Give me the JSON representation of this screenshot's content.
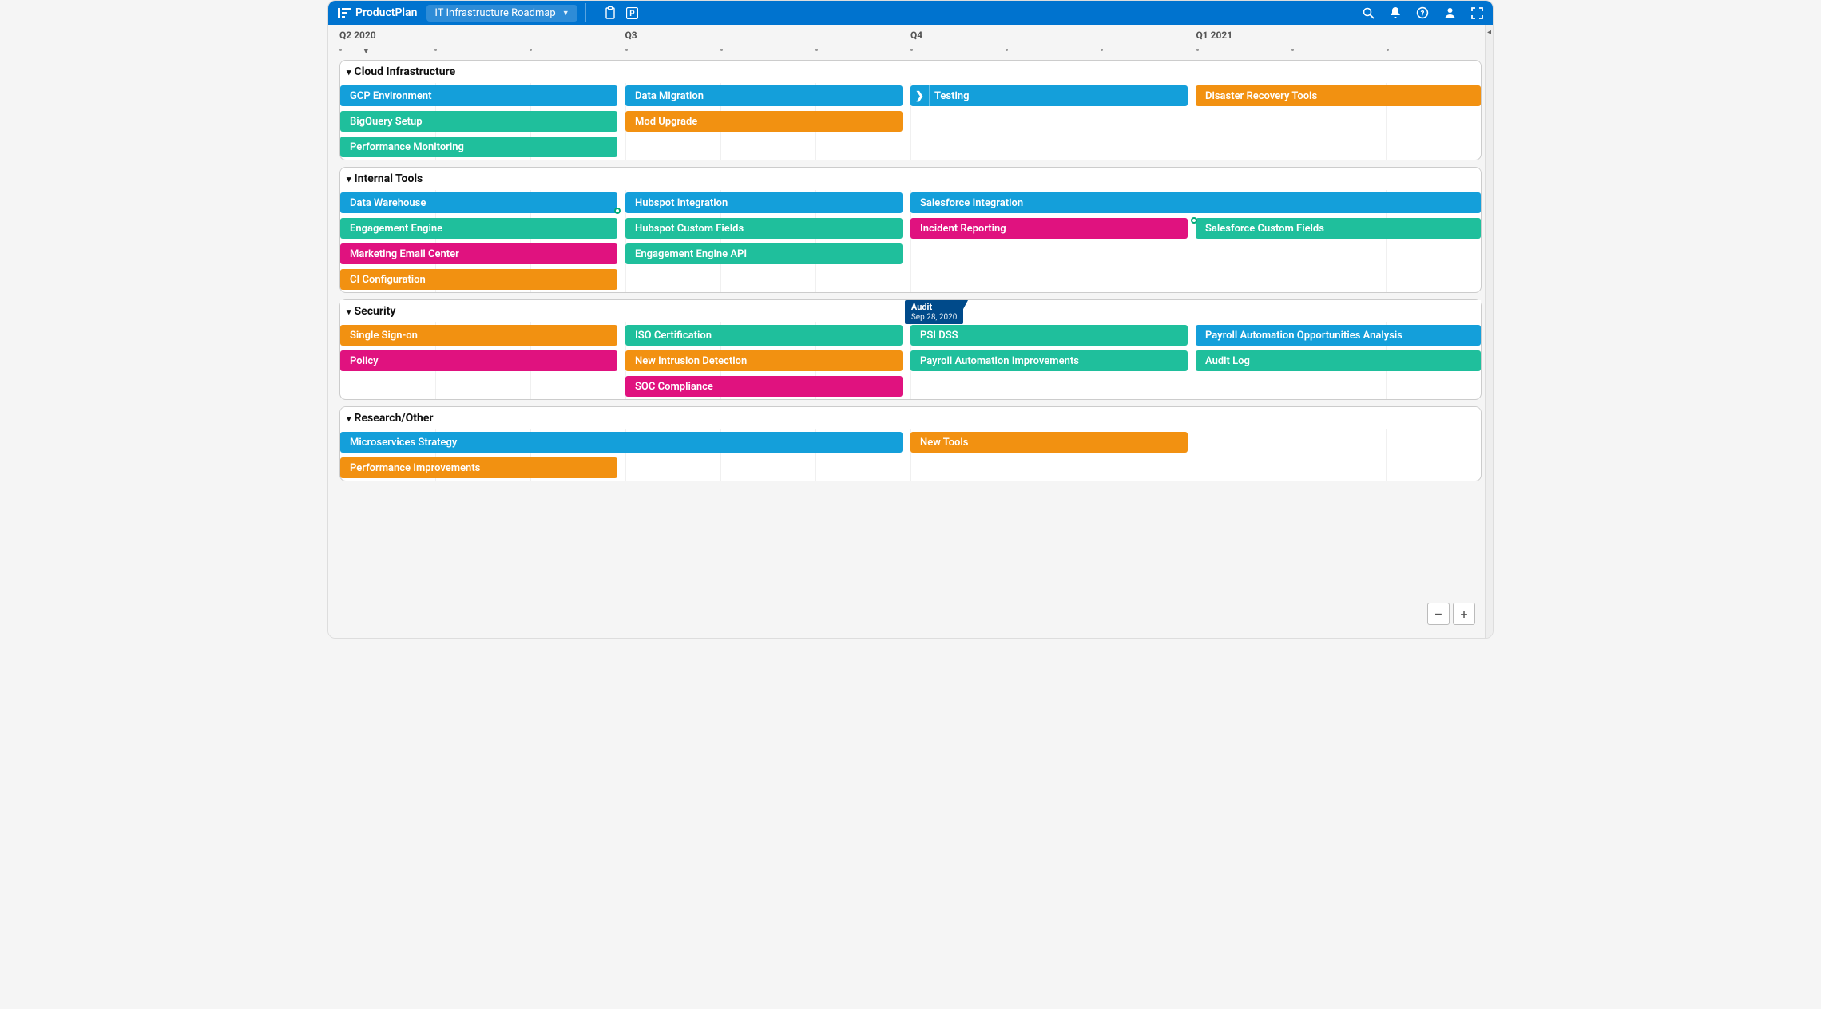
{
  "brand": "ProductPlan",
  "roadmap_name": "IT Infrastructure Roadmap",
  "timeline": {
    "labels": [
      {
        "text": "Q2 2020",
        "pct": 0
      },
      {
        "text": "Q3",
        "pct": 25
      },
      {
        "text": "Q4",
        "pct": 50
      },
      {
        "text": "Q1 2021",
        "pct": 75
      }
    ],
    "today_pct": 2.3
  },
  "milestone": {
    "title": "Audit",
    "date": "Sep 28, 2020",
    "left_pct": 49.5
  },
  "colors": {
    "blue": "#149fda",
    "teal": "#1fbf9c",
    "orange": "#f29111",
    "pink": "#e0127f"
  },
  "zoom": {
    "out_label": "–",
    "in_label": "+"
  },
  "lanes": [
    {
      "name": "Cloud Infrastructure",
      "rows": [
        [
          {
            "label": "GCP Environment",
            "color": "blue",
            "start": 0,
            "end": 24.3
          },
          {
            "label": "Data Migration",
            "color": "blue",
            "start": 25,
            "end": 49.3
          },
          {
            "label": "Testing",
            "color": "blue",
            "start": 50,
            "end": 74.3,
            "has_chevron": true
          },
          {
            "label": "Disaster Recovery Tools",
            "color": "orange",
            "start": 75,
            "end": 100
          }
        ],
        [
          {
            "label": "BigQuery Setup",
            "color": "teal",
            "start": 0,
            "end": 24.3
          },
          {
            "label": "Mod Upgrade",
            "color": "orange",
            "start": 25,
            "end": 49.3
          }
        ],
        [
          {
            "label": "Performance Monitoring",
            "color": "teal",
            "start": 0,
            "end": 24.3
          }
        ]
      ]
    },
    {
      "name": "Internal Tools",
      "rows": [
        [
          {
            "label": "Data Warehouse",
            "color": "blue",
            "start": 0,
            "end": 24.3,
            "conn_out": true
          },
          {
            "label": "Hubspot Integration",
            "color": "blue",
            "start": 25,
            "end": 49.3
          },
          {
            "label": "Salesforce Integration",
            "color": "blue",
            "start": 50,
            "end": 100
          }
        ],
        [
          {
            "label": "Engagement Engine",
            "color": "teal",
            "start": 0,
            "end": 24.3
          },
          {
            "label": "Hubspot Custom Fields",
            "color": "teal",
            "start": 25,
            "end": 49.3
          },
          {
            "label": "Incident Reporting",
            "color": "pink",
            "start": 50,
            "end": 74.3
          },
          {
            "label": "Salesforce Custom Fields",
            "color": "teal",
            "start": 75,
            "end": 100,
            "conn_in": true
          }
        ],
        [
          {
            "label": "Marketing Email Center",
            "color": "pink",
            "start": 0,
            "end": 24.3
          },
          {
            "label": "Engagement Engine API",
            "color": "teal",
            "start": 25,
            "end": 49.3
          }
        ],
        [
          {
            "label": "CI Configuration",
            "color": "orange",
            "start": 0,
            "end": 24.3
          }
        ]
      ]
    },
    {
      "name": "Security",
      "rows": [
        [
          {
            "label": "Single Sign-on",
            "color": "orange",
            "start": 0,
            "end": 24.3
          },
          {
            "label": "ISO Certification",
            "color": "teal",
            "start": 25,
            "end": 49.3
          },
          {
            "label": "PSI DSS",
            "color": "teal",
            "start": 50,
            "end": 74.3
          },
          {
            "label": "Payroll Automation Opportunities Analysis",
            "color": "blue",
            "start": 75,
            "end": 100
          }
        ],
        [
          {
            "label": "Policy",
            "color": "pink",
            "start": 0,
            "end": 24.3
          },
          {
            "label": "New Intrusion Detection",
            "color": "orange",
            "start": 25,
            "end": 49.3
          },
          {
            "label": "Payroll Automation Improvements",
            "color": "teal",
            "start": 50,
            "end": 74.3
          },
          {
            "label": "Audit Log",
            "color": "teal",
            "start": 75,
            "end": 100
          }
        ],
        [
          {
            "label": "SOC Compliance",
            "color": "pink",
            "start": 25,
            "end": 49.3
          }
        ]
      ]
    },
    {
      "name": "Research/Other",
      "rows": [
        [
          {
            "label": "Microservices Strategy",
            "color": "blue",
            "start": 0,
            "end": 49.3
          },
          {
            "label": "New Tools",
            "color": "orange",
            "start": 50,
            "end": 74.3
          }
        ],
        [
          {
            "label": "Performance Improvements",
            "color": "orange",
            "start": 0,
            "end": 24.3
          }
        ]
      ]
    }
  ]
}
